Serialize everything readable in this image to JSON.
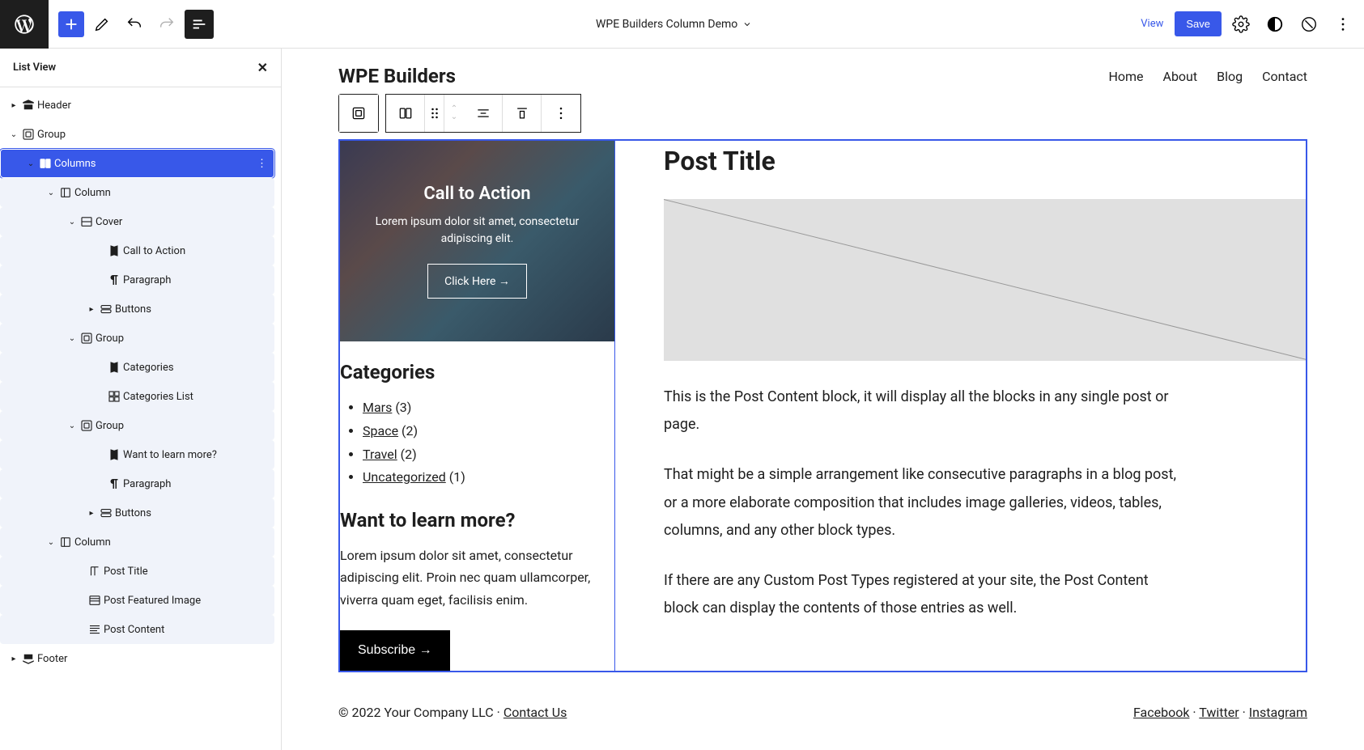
{
  "topbar": {
    "doc_title": "WPE Builders Column Demo",
    "view_label": "View",
    "save_label": "Save"
  },
  "sidebar": {
    "title": "List View",
    "items": [
      {
        "label": "Header"
      },
      {
        "label": "Group"
      },
      {
        "label": "Columns"
      },
      {
        "label": "Column"
      },
      {
        "label": "Cover"
      },
      {
        "label": "Call to Action"
      },
      {
        "label": "Paragraph"
      },
      {
        "label": "Buttons"
      },
      {
        "label": "Group"
      },
      {
        "label": "Categories"
      },
      {
        "label": "Categories List"
      },
      {
        "label": "Group"
      },
      {
        "label": "Want to learn more?"
      },
      {
        "label": "Paragraph"
      },
      {
        "label": "Buttons"
      },
      {
        "label": "Column"
      },
      {
        "label": "Post Title"
      },
      {
        "label": "Post Featured Image"
      },
      {
        "label": "Post Content"
      },
      {
        "label": "Footer"
      }
    ]
  },
  "site": {
    "title": "WPE Builders",
    "nav": [
      "Home",
      "About",
      "Blog",
      "Contact"
    ]
  },
  "cover": {
    "heading": "Call to Action",
    "text": "Lorem ipsum dolor sit amet, consectetur adipiscing elit.",
    "button": "Click Here →"
  },
  "categories": {
    "heading": "Categories",
    "items": [
      {
        "name": "Mars",
        "count": "(3)"
      },
      {
        "name": "Space",
        "count": "(2)"
      },
      {
        "name": "Travel",
        "count": "(2)"
      },
      {
        "name": "Uncategorized",
        "count": "(1)"
      }
    ]
  },
  "learn": {
    "heading": "Want to learn more?",
    "text": "Lorem ipsum dolor sit amet, consectetur adipiscing elit. Proin nec quam ullamcorper, viverra quam eget, facilisis enim.",
    "button": "Subscribe →"
  },
  "post": {
    "title": "Post Title",
    "p1": "This is the Post Content block, it will display all the blocks in any single post or page.",
    "p2": "That might be a simple arrangement like consecutive paragraphs in a blog post, or a more elaborate composition that includes image galleries, videos, tables, columns, and any other block types.",
    "p3": "If there are any Custom Post Types registered at your site, the Post Content block can display the contents of those entries as well."
  },
  "footer": {
    "copyright": "© 2022 Your Company LLC · ",
    "contact": "Contact Us",
    "social": [
      "Facebook",
      "Twitter",
      "Instagram"
    ],
    "sep": " · "
  }
}
